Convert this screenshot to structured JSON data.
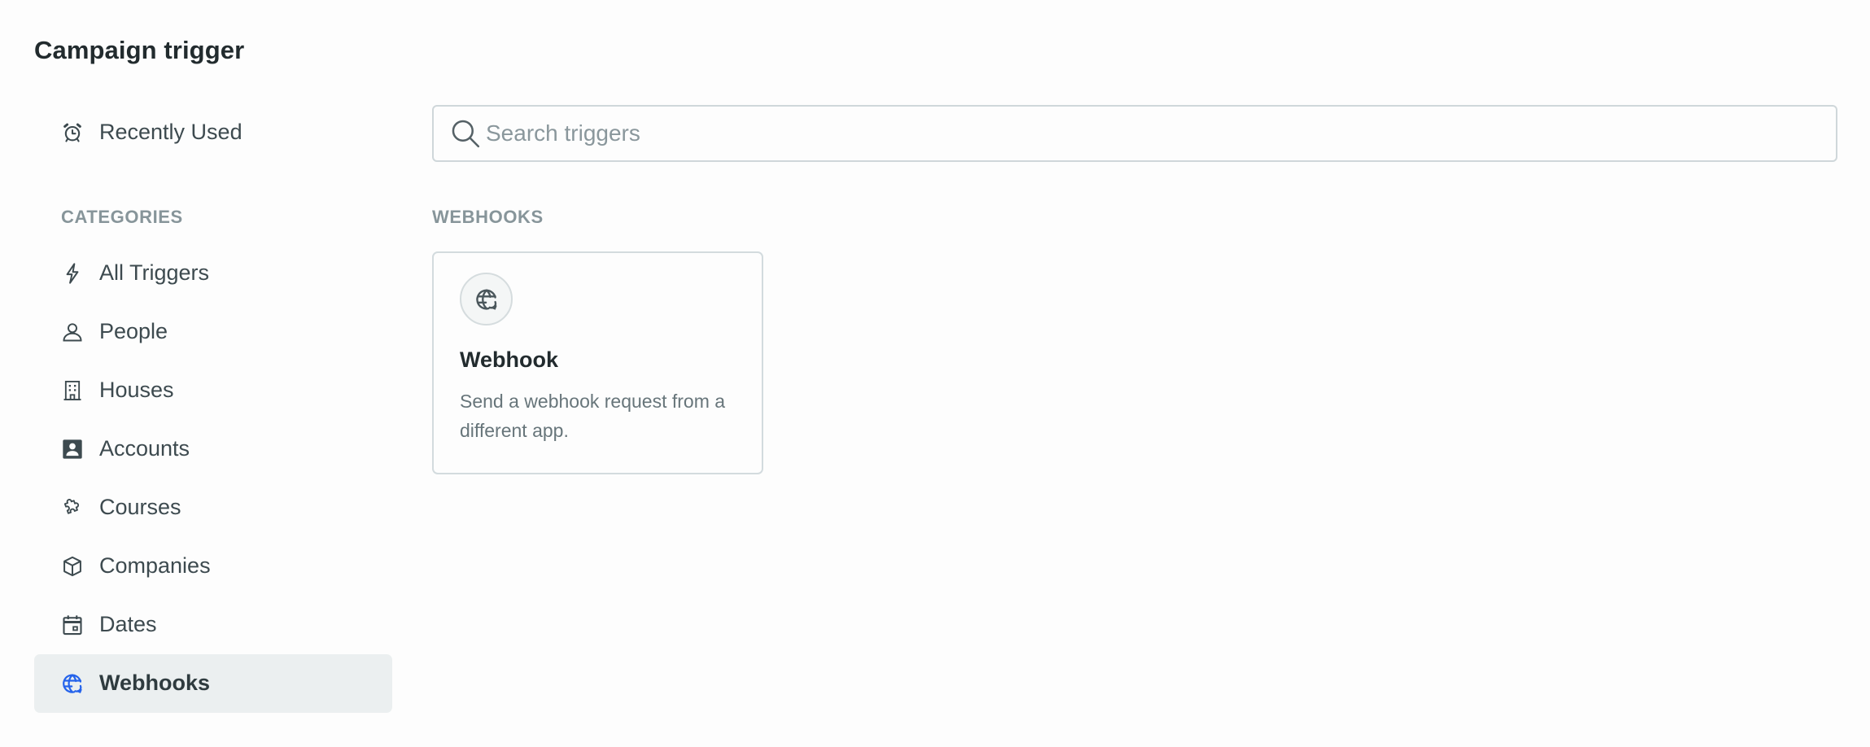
{
  "header": {
    "title": "Campaign trigger"
  },
  "sidebar": {
    "recent": {
      "label": "Recently Used",
      "icon": "alarm-clock-icon"
    },
    "categories_label": "CATEGORIES",
    "items": [
      {
        "label": "All Triggers",
        "icon": "lightning-bolt-icon",
        "active": false
      },
      {
        "label": "People",
        "icon": "person-icon",
        "active": false
      },
      {
        "label": "Houses",
        "icon": "building-icon",
        "active": false
      },
      {
        "label": "Accounts",
        "icon": "account-card-icon",
        "active": false
      },
      {
        "label": "Courses",
        "icon": "puzzle-piece-icon",
        "active": false
      },
      {
        "label": "Companies",
        "icon": "cube-icon",
        "active": false
      },
      {
        "label": "Dates",
        "icon": "calendar-icon",
        "active": false
      },
      {
        "label": "Webhooks",
        "icon": "globe-sync-icon",
        "active": true
      }
    ]
  },
  "search": {
    "placeholder": "Search triggers",
    "value": ""
  },
  "main": {
    "section_label": "WEBHOOKS",
    "cards": [
      {
        "title": "Webhook",
        "description": "Send a webhook request from a different app.",
        "icon": "globe-sync-icon"
      }
    ]
  },
  "colors": {
    "accent": "#2563eb",
    "active_bg": "#ebeff0",
    "text": "#3d4a4f",
    "muted": "#87959a",
    "border": "#cfd7da"
  }
}
